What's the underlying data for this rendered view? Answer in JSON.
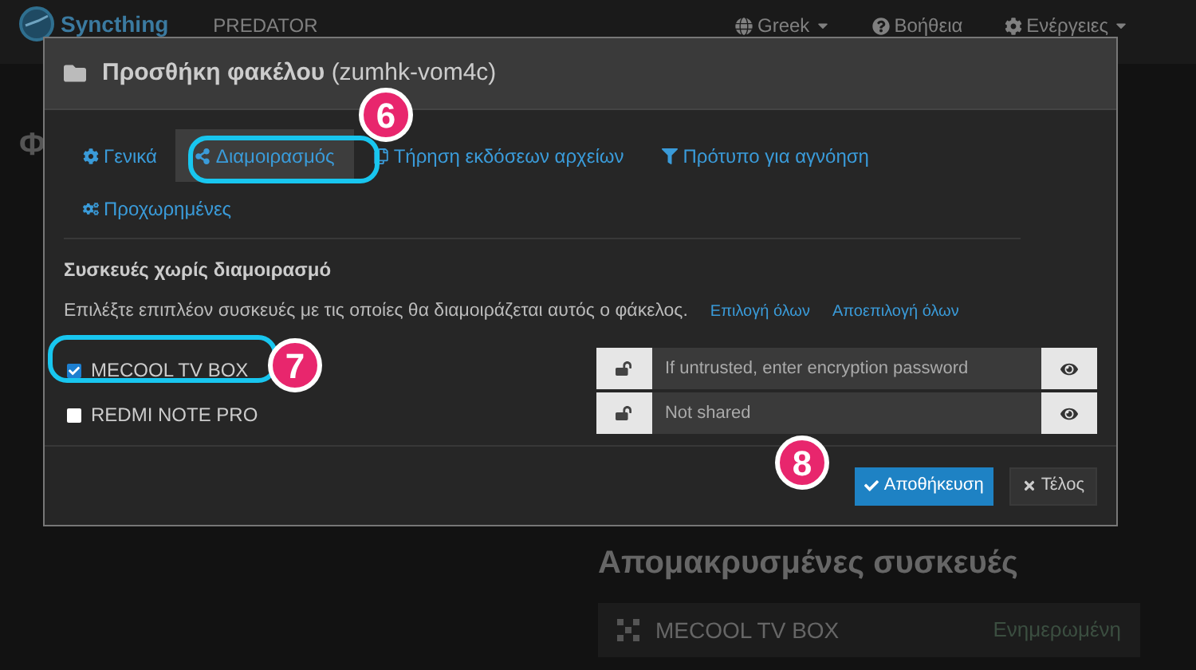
{
  "navbar": {
    "brand": "Syncthing",
    "device": "PREDATOR",
    "menus": [
      {
        "label": "Greek",
        "kind": "language"
      },
      {
        "label": "Βοήθεια",
        "kind": "help"
      },
      {
        "label": "Ενέργειες",
        "kind": "actions"
      }
    ]
  },
  "background": {
    "left_heading": "Φ",
    "remote_heading": "Απομακρυσμένες συσκευές",
    "remote_devices": [
      {
        "name": "MECOOL TV BOX",
        "status": "Ενημερωμένη"
      }
    ]
  },
  "dialog": {
    "title_bold": "Προσθήκη φακέλου",
    "title_id": "(zumhk-vom4c)",
    "tabs": [
      {
        "label": "Γενικά",
        "kind": "general",
        "selected": false
      },
      {
        "label": "Διαμοιρασμός",
        "kind": "sharing",
        "selected": true
      },
      {
        "label": "Τήρηση εκδόσεων αρχείων",
        "kind": "versioning",
        "selected": false
      },
      {
        "label": "Πρότυπο για αγνόηση",
        "kind": "ignore",
        "selected": false
      },
      {
        "label": "Προχωρημένες",
        "kind": "advanced",
        "selected": false
      }
    ],
    "section_title": "Συσκευές χωρίς διαμοιρασμό",
    "hint": "Επιλέξτε επιπλέον συσκευές με τις οποίες θα διαμοιράζεται αυτός ο φάκελος.",
    "select_all": "Επιλογή όλων",
    "deselect_all": "Αποεπιλογή όλων",
    "devices": [
      {
        "name": "MECOOL TV BOX",
        "checked": true,
        "placeholder": "If untrusted, enter encryption password"
      },
      {
        "name": "REDMI NOTE PRO",
        "checked": false,
        "placeholder": "Not shared"
      }
    ],
    "save": "Αποθήκευση",
    "close": "Τέλος"
  },
  "callouts": [
    {
      "label": "6"
    },
    {
      "label": "7"
    },
    {
      "label": "8"
    }
  ]
}
